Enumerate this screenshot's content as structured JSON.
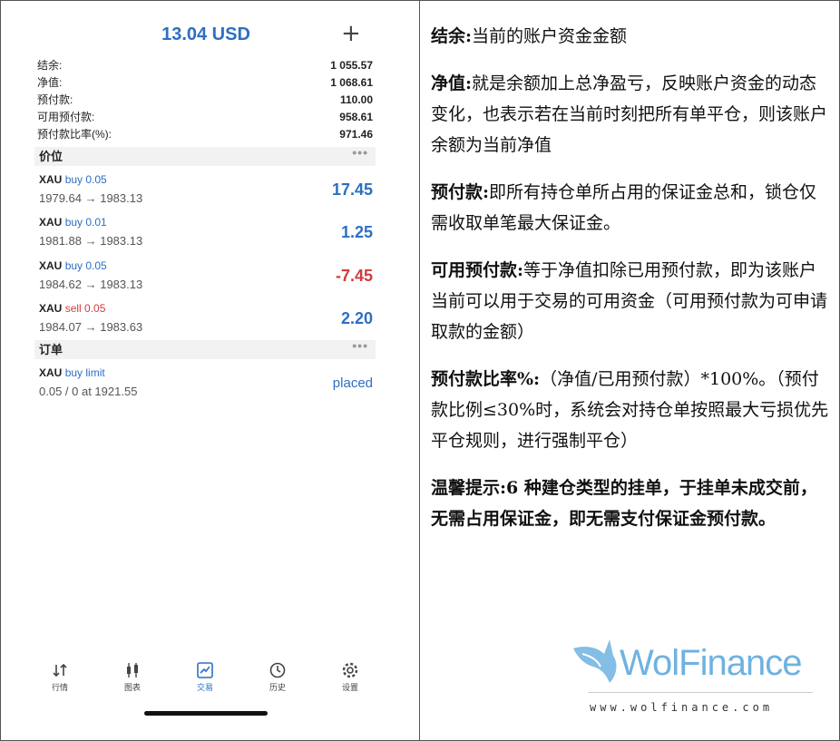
{
  "header": {
    "balance_title": "13.04 USD",
    "add_icon": "plus-icon"
  },
  "summary": [
    {
      "label": "结余:",
      "value": "1 055.57"
    },
    {
      "label": "净值:",
      "value": "1 068.61"
    },
    {
      "label": "预付款:",
      "value": "110.00"
    },
    {
      "label": "可用预付款:",
      "value": "958.61"
    },
    {
      "label": "预付款比率(%):",
      "value": "971.46"
    }
  ],
  "sections": {
    "positions": "价位",
    "orders": "订单",
    "more": "•••"
  },
  "positions": [
    {
      "symbol": "XAU",
      "side": "buy 0.05",
      "prices": "1979.64 → 1983.13",
      "pl": "17.45"
    },
    {
      "symbol": "XAU",
      "side": "buy 0.01",
      "prices": "1981.88 → 1983.13",
      "pl": "1.25"
    },
    {
      "symbol": "XAU",
      "side": "buy 0.05",
      "prices": "1984.62 → 1983.13",
      "pl": "-7.45"
    },
    {
      "symbol": "XAU",
      "side": "sell 0.05",
      "prices": "1984.07 → 1983.63",
      "pl": "2.20"
    }
  ],
  "orders": [
    {
      "symbol": "XAU",
      "side": "buy limit",
      "detail": "0.05 / 0 at 1921.55",
      "status": "placed"
    }
  ],
  "tabs": [
    {
      "label": "行情",
      "icon": "quotes-icon"
    },
    {
      "label": "图表",
      "icon": "candlestick-icon"
    },
    {
      "label": "交易",
      "icon": "trade-chart-icon",
      "active": true
    },
    {
      "label": "历史",
      "icon": "history-icon"
    },
    {
      "label": "设置",
      "icon": "gear-icon"
    }
  ],
  "colors": {
    "accent": "#2d6fc4",
    "negative": "#d23b3b"
  },
  "explanations": [
    {
      "term": "结余:",
      "text": "当前的账户资金金额"
    },
    {
      "term": "净值:",
      "text": "就是余额加上总净盈亏，反映账户资金的动态变化，也表示若在当前时刻把所有单平仓，则该账户余额为当前净值"
    },
    {
      "term": "预付款:",
      "text": "即所有持仓单所占用的保证金总和，锁仓仅需收取单笔最大保证金。"
    },
    {
      "term": "可用预付款:",
      "text": "等于净值扣除已用预付款，即为该账户当前可以用于交易的可用资金（可用预付款为可申请取款的金额）"
    },
    {
      "term": "预付款比率%:",
      "text": "（净值/已用预付款）*100%。（预付款比例≤30%时，系统会对持仓单按照最大亏损优先平仓规则，进行强制平仓）"
    },
    {
      "term": "温馨提示:",
      "text": "6 种建仓类型的挂单，于挂单未成交前，无需占用保证金，即无需支付保证金预付款。"
    }
  ],
  "logo": {
    "brand": "WolFinance",
    "url": "www.wolfinance.com"
  }
}
